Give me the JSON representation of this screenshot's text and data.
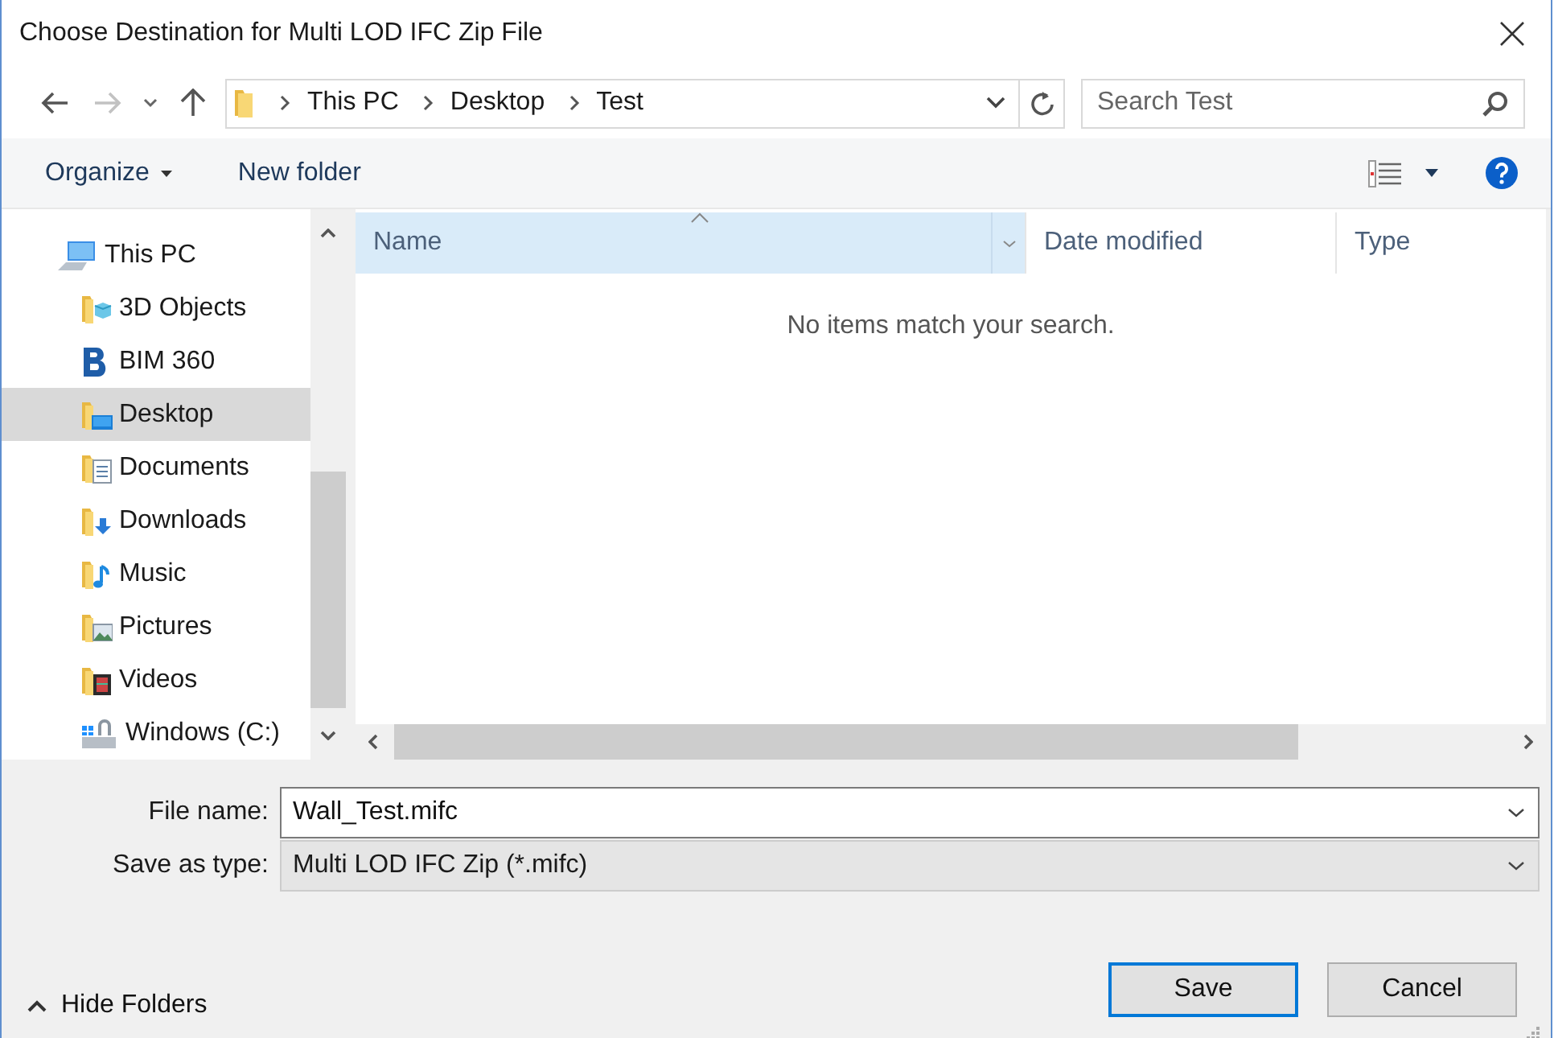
{
  "window": {
    "title": "Choose Destination for Multi LOD IFC Zip File"
  },
  "breadcrumb": [
    "This PC",
    "Desktop",
    "Test"
  ],
  "search": {
    "placeholder": "Search Test"
  },
  "toolbar": {
    "organize": "Organize",
    "new_folder": "New folder"
  },
  "nav_pane": {
    "items": [
      {
        "label": "This PC",
        "kind": "pc",
        "selected": false,
        "children": [
          {
            "label": "3D Objects",
            "kind": "objects3d",
            "selected": false
          },
          {
            "label": "BIM 360",
            "kind": "bim",
            "selected": false
          },
          {
            "label": "Desktop",
            "kind": "desktop",
            "selected": true
          },
          {
            "label": "Documents",
            "kind": "documents",
            "selected": false
          },
          {
            "label": "Downloads",
            "kind": "downloads",
            "selected": false
          },
          {
            "label": "Music",
            "kind": "music",
            "selected": false
          },
          {
            "label": "Pictures",
            "kind": "pictures",
            "selected": false
          },
          {
            "label": "Videos",
            "kind": "videos",
            "selected": false
          },
          {
            "label": "Windows (C:)",
            "kind": "drive",
            "selected": false
          }
        ]
      }
    ]
  },
  "file_list": {
    "columns": [
      {
        "label": "Name",
        "sorted": true
      },
      {
        "label": "Date modified",
        "sorted": false
      },
      {
        "label": "Type",
        "sorted": false
      }
    ],
    "empty_message": "No items match your search."
  },
  "form": {
    "file_name": {
      "label": "File name:",
      "value": "Wall_Test.mifc"
    },
    "save_as_type": {
      "label": "Save as type:",
      "value": "Multi LOD IFC Zip (*.mifc)"
    }
  },
  "hide_folders": "Hide Folders",
  "buttons": [
    {
      "label": "Save",
      "default": true
    },
    {
      "label": "Cancel",
      "default": false
    }
  ]
}
